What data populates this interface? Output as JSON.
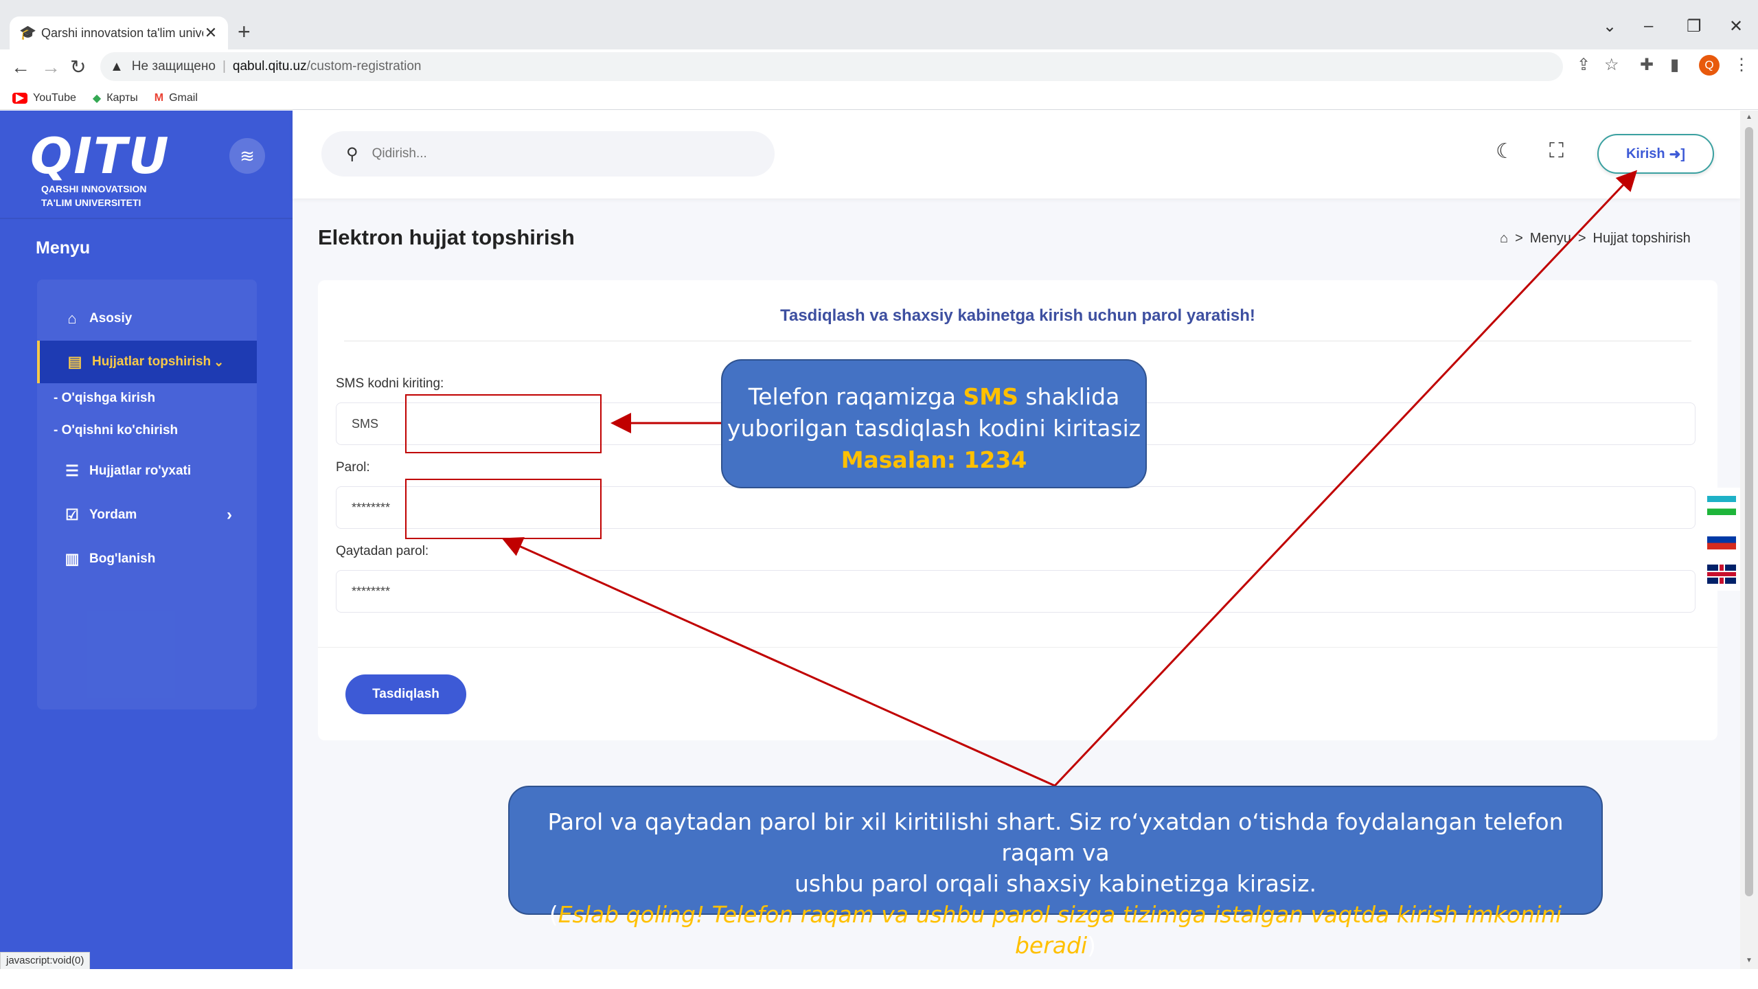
{
  "browser": {
    "tab_title": "Qarshi innovatsion ta'lim univers",
    "tab_close": "✕",
    "new_tab": "+",
    "security": "Не защищено",
    "url_host": "qabul.qitu.uz",
    "url_path": "/custom-registration",
    "bookmarks": [
      "YouTube",
      "Карты",
      "Gmail"
    ],
    "profile_letter": "Q",
    "status_text": "javascript:void(0)"
  },
  "sidebar": {
    "logo_text": "QITU",
    "logo_sub_line1": "QARSHI INNOVATSION",
    "logo_sub_line2": "TA'LIM UNIVERSITETI",
    "menu_title": "Menyu",
    "items": [
      {
        "label": "Asosiy",
        "icon": "home-icon"
      },
      {
        "label": "Hujjatlar topshirish",
        "icon": "document-icon"
      },
      {
        "label": "Hujjatlar ro'yxati",
        "icon": "list-icon"
      },
      {
        "label": "Yordam",
        "icon": "checkbox-icon"
      },
      {
        "label": "Bog'lanish",
        "icon": "map-icon"
      }
    ],
    "subitems": [
      "- O'qishga kirish",
      "- O'qishni ko'chirish"
    ]
  },
  "topbar": {
    "search_placeholder": "Qidirish...",
    "login_label": "Kirish"
  },
  "page": {
    "title": "Elektron hujjat topshirish",
    "breadcrumb": [
      "Menyu",
      "Hujjat topshirish"
    ]
  },
  "form": {
    "heading": "Tasdiqlash va shaxsiy kabinetga kirish uchun parol yaratish!",
    "sms_label": "SMS kodni kiriting:",
    "sms_placeholder": "SMS",
    "password_label": "Parol:",
    "password_placeholder": "********",
    "repeat_label": "Qaytadan parol:",
    "repeat_placeholder": "********",
    "submit_label": "Tasdiqlash"
  },
  "annotations": {
    "callout1": {
      "line1_pre": "Telefon raqamizga ",
      "line1_hl": "SMS",
      "line1_post": " shaklida",
      "line2": "yuborilgan tasdiqlash kodini kiritasiz",
      "line3": "Masalan: 1234"
    },
    "callout2": {
      "line1": "Parol va qaytadan parol bir xil kiritilishi shart. Siz ro‘yxatdan o‘tishda foydalangan telefon raqam va",
      "line2": "ushbu parol orqali shaxsiy kabinetizga kirasiz.",
      "line3_open": "(",
      "line3_italic": "Eslab qoling! Telefon raqam va ushbu parol sizga tizimga istalgan vaqtda kirish imkonini beradi",
      "line3_close": ")"
    }
  },
  "colors": {
    "sidebar": "#3d5ad6",
    "accent": "#3d5ad6",
    "callout": "#4472c4",
    "highlight": "#ffc000",
    "annotation_red": "#c00000"
  }
}
